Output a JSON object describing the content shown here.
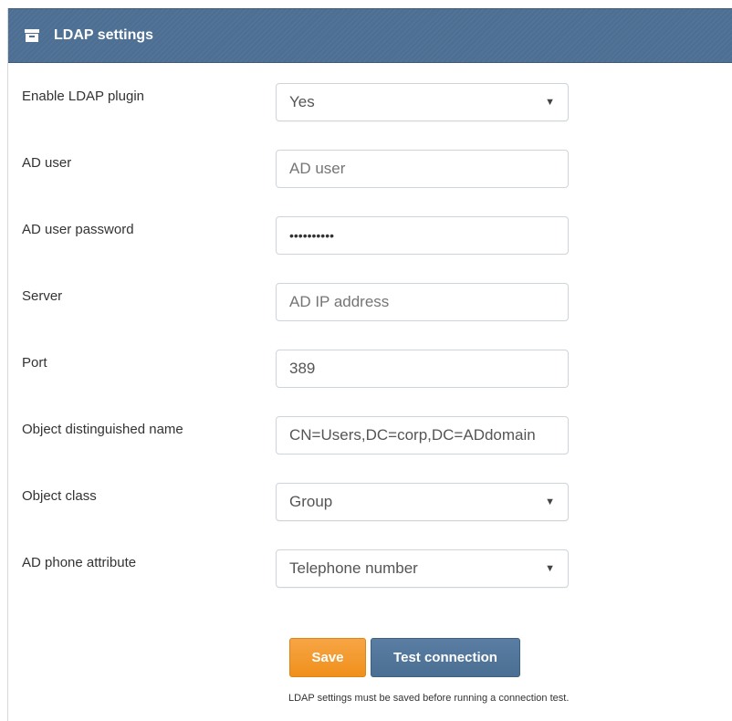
{
  "panel": {
    "title": "LDAP settings",
    "icon": "archive-box-icon",
    "header_color": "#4d6f93"
  },
  "form": {
    "enable_plugin": {
      "label": "Enable LDAP plugin",
      "value": "Yes"
    },
    "ad_user": {
      "label": "AD user",
      "placeholder": "AD user",
      "value": ""
    },
    "ad_user_password": {
      "label": "AD user password",
      "value": "••••••••••"
    },
    "server": {
      "label": "Server",
      "placeholder": "AD IP address",
      "value": ""
    },
    "port": {
      "label": "Port",
      "value": "389"
    },
    "object_dn": {
      "label": "Object distinguished name",
      "value": "CN=Users,DC=corp,DC=ADdomain"
    },
    "object_class": {
      "label": "Object class",
      "value": "Group"
    },
    "phone_attribute": {
      "label": "AD phone attribute",
      "value": "Telephone number"
    }
  },
  "actions": {
    "save_label": "Save",
    "save_color": "#f0901c",
    "test_label": "Test connection",
    "test_color": "#4b6e93",
    "note": "LDAP settings must be saved before running a connection test."
  }
}
